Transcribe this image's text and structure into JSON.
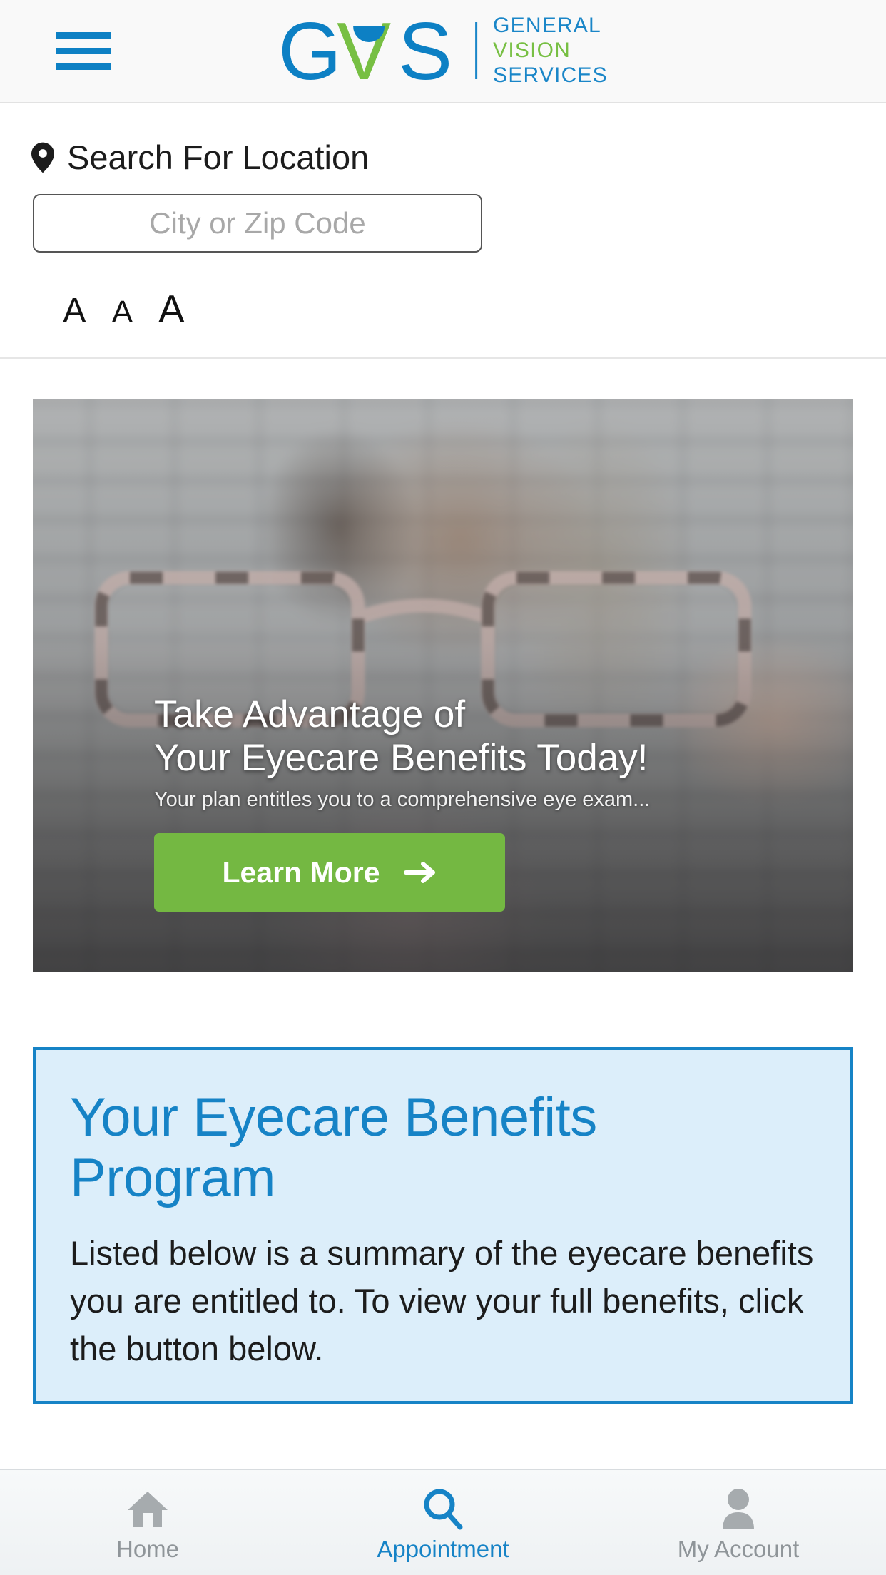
{
  "header": {
    "menu_icon": "hamburger-icon",
    "logo": {
      "mark_letters": "GVS",
      "line1": "GENERAL",
      "line2": "VISION",
      "line3": "SERVICES",
      "blue": "#1a86c8",
      "green": "#77bf43"
    }
  },
  "search": {
    "pin_icon": "location-pin-icon",
    "label": "Search For Location",
    "placeholder": "City or Zip Code",
    "value": "",
    "font_sizes": [
      "A",
      "A",
      "A"
    ]
  },
  "hero": {
    "title_line1": "Take Advantage of",
    "title_line2": "Your Eyecare Benefits Today!",
    "subtitle": "Your plan entitles you to a comprehensive eye exam...",
    "button_label": "Learn More",
    "button_icon": "arrow-right-icon",
    "button_color": "#74b842"
  },
  "benefits": {
    "title": "Your Eyecare Benefits Program",
    "body": "Listed below is a summary of the eyecare benefits you are entitled to. To view your full benefits, click the button below.",
    "border_color": "#1683c6",
    "background_color": "#dceefa"
  },
  "bottom_nav": {
    "items": [
      {
        "label": "Home",
        "icon": "home-icon",
        "active": false
      },
      {
        "label": "Appointment",
        "icon": "search-magnifier-icon",
        "active": true
      },
      {
        "label": "My Account",
        "icon": "person-icon",
        "active": false
      }
    ],
    "active_color": "#1683c6",
    "inactive_color": "#8f9599"
  }
}
